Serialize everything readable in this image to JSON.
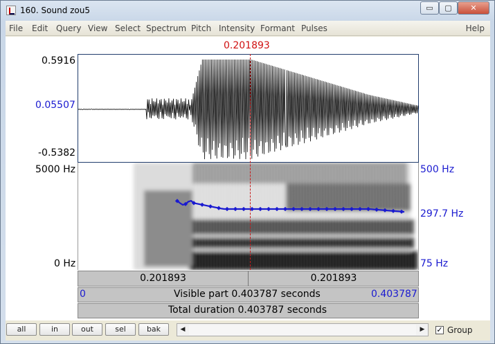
{
  "window": {
    "title": "160. Sound zou5",
    "controls": {
      "minimize": "▭",
      "maximize": "▢",
      "close": "✕"
    }
  },
  "menu": {
    "items": [
      "File",
      "Edit",
      "Query",
      "View",
      "Select",
      "Spectrum",
      "Pitch",
      "Intensity",
      "Formant",
      "Pulses"
    ],
    "help": "Help"
  },
  "cursor": {
    "time": "0.201893"
  },
  "waveform": {
    "y_max": "0.5916",
    "y_zero": "0.05507",
    "y_min": "-0.5382"
  },
  "spectrogram": {
    "freq_max": "5000 Hz",
    "freq_min": "0 Hz",
    "pitch_max": "500 Hz",
    "pitch_current": "297.7 Hz",
    "pitch_min": "75 Hz"
  },
  "time_bars": {
    "left_segment": "0.201893",
    "right_segment": "0.201893",
    "visible_start": "0",
    "visible_label": "Visible part 0.403787 seconds",
    "visible_end": "0.403787",
    "total_label": "Total duration 0.403787 seconds"
  },
  "buttons": {
    "all": "all",
    "in": "in",
    "out": "out",
    "sel": "sel",
    "bak": "bak"
  },
  "scrollbar": {
    "left_arrow": "◀",
    "right_arrow": "▶"
  },
  "group": {
    "label": "Group",
    "checked": "✓"
  },
  "colors": {
    "cursor": "#d01010",
    "pitch": "#1a1ad0",
    "waveform": "#000000",
    "frame": "#1f3b6b"
  }
}
